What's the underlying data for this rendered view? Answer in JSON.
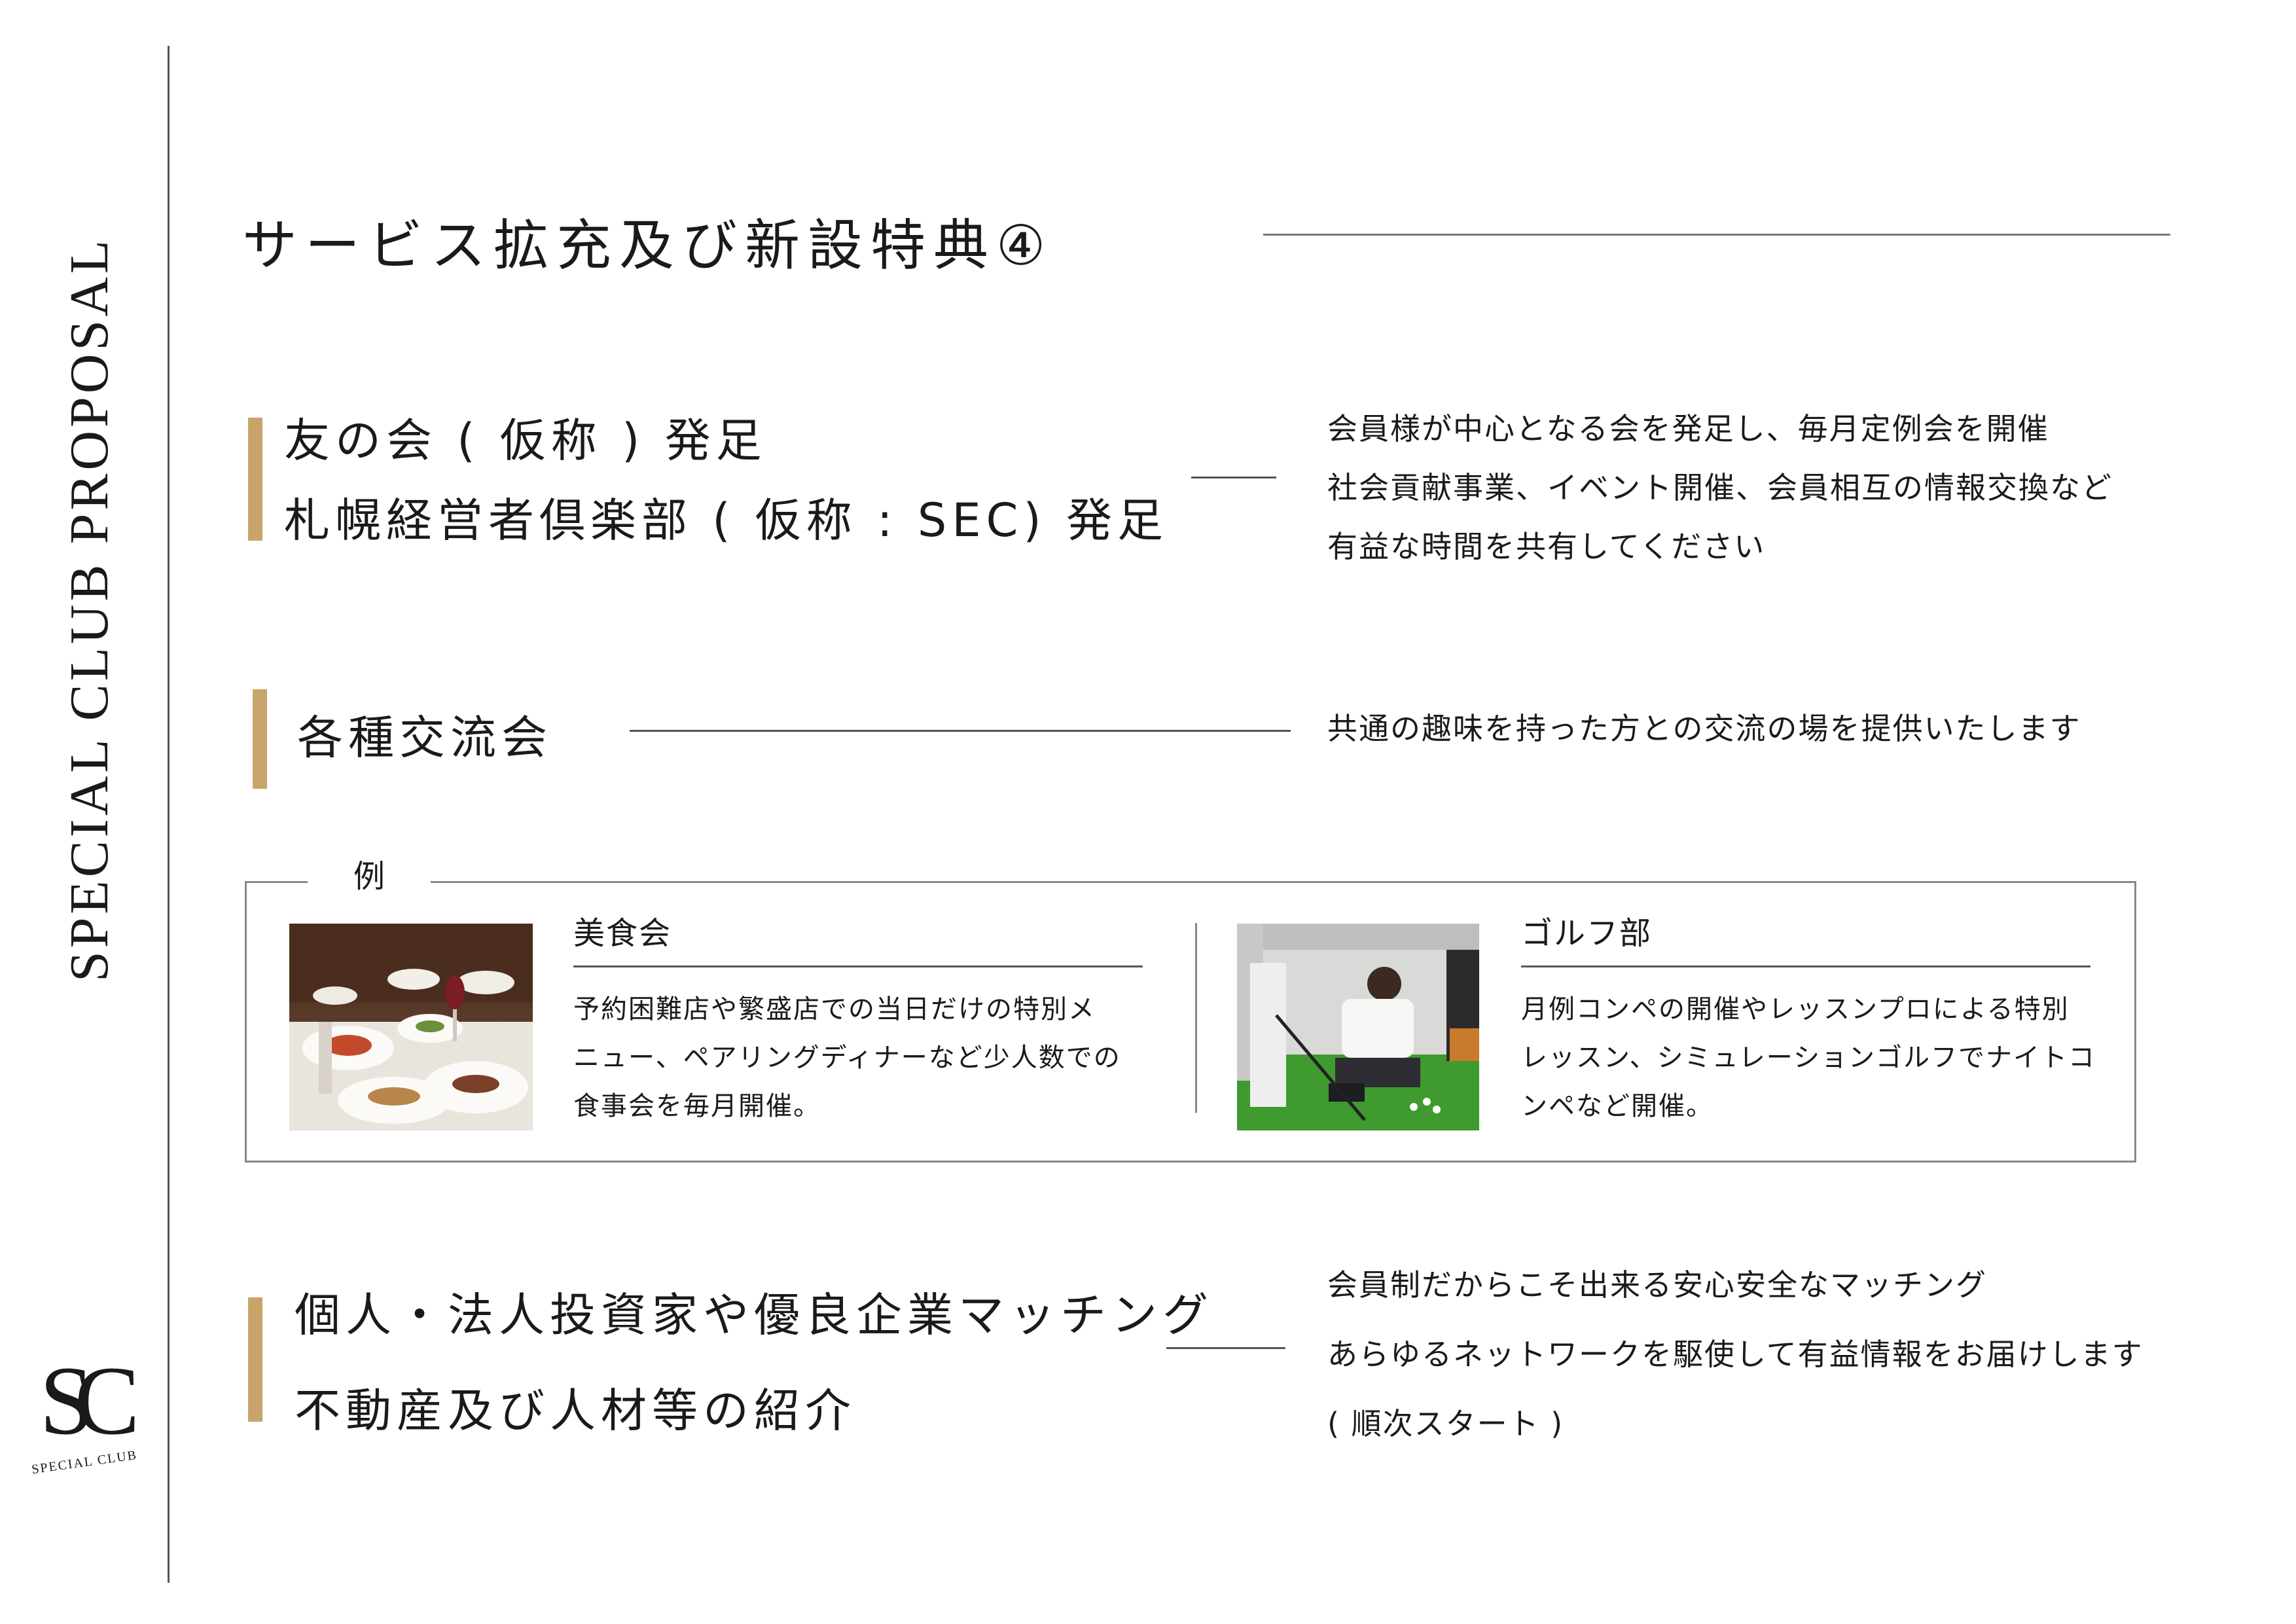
{
  "sidebar": {
    "vertical_title": "SPECIAL CLUB PROPOSAL",
    "logo_monogram": "SC",
    "logo_caption": "SPECIAL CLUB"
  },
  "page": {
    "title": "サービス拡充及び新設特典④"
  },
  "sections": [
    {
      "heading_lines": [
        "友の会 ( 仮称 ) 発足",
        "札幌経営者倶楽部 ( 仮称 : SEC) 発足"
      ],
      "description_lines": [
        "会員様が中心となる会を発足し、毎月定例会を開催",
        "社会貢献事業、イベント開催、会員相互の情報交換など",
        "有益な時間を共有してください"
      ]
    },
    {
      "heading_lines": [
        "各種交流会"
      ],
      "description_lines": [
        "共通の趣味を持った方との交流の場を提供いたします"
      ]
    },
    {
      "heading_lines": [
        "個人・法人投資家や優良企業マッチング",
        "不動産及び人材等の紹介"
      ],
      "description_lines": [
        "会員制だからこそ出来る安心安全なマッチング",
        "あらゆるネットワークを駆使して有益情報をお届けします",
        "( 順次スタート )"
      ]
    }
  ],
  "examples": {
    "label": "例",
    "items": [
      {
        "title": "美食会",
        "text_lines": [
          "予約困難店や繁盛店での当日だけの特別メ",
          "ニュー、ペアリングディナーなど少人数での",
          "食事会を毎月開催。"
        ]
      },
      {
        "title": "ゴルフ部",
        "text_lines": [
          "月例コンペの開催やレッスンプロによる特別",
          "レッスン、シミュレーションゴルフでナイトコ",
          "ンペなど開催。"
        ]
      }
    ]
  },
  "colors": {
    "accent_gold": "#c9a46a",
    "text": "#1a1a1a",
    "rule": "#555555"
  }
}
